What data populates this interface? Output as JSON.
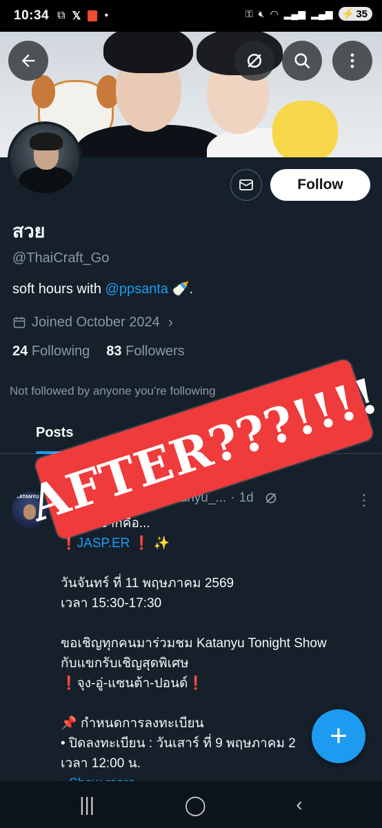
{
  "status_bar": {
    "time": "10:34",
    "battery": "35"
  },
  "banner": {
    "back_icon": "arrow-left-icon",
    "grok_icon": "grok-icon",
    "search_icon": "search-icon",
    "more_icon": "more-vertical-icon"
  },
  "profile": {
    "name": "สวย",
    "handle": "@ThaiCraft_Go",
    "bio_prefix": "soft hours with ",
    "bio_mention": "@ppsanta",
    "bio_suffix": " 🍼.",
    "joined": "Joined October 2024",
    "following_count": "24",
    "following_label": "Following",
    "followers_count": "83",
    "followers_label": "Followers",
    "not_followed": "Not followed by anyone you’re following",
    "follow_label": "Follow"
  },
  "tabs": {
    "posts": "Posts"
  },
  "tweet": {
    "handle": "@katanyu_...",
    "dot": "·",
    "time": "1d",
    "lines": [
      "…..ในเงาก็คือ...",
      "❗JASP.ER ❗ ✨",
      "",
      "วันจันทร์ ที่ 11 พฤษภาคม 2569",
      "เวลา 15:30-17:30",
      "",
      "ขอเชิญทุกคนมาร่วมชม Katanyu Tonight Show",
      "กับแขกรับเชิญสุดพิเศษ",
      "❗จุง-อู่-แซนต้า-ปอนด์❗",
      "",
      "📌 กำหนดการลงทะเบียน",
      "• ปิดลงทะเบียน : วันเสาร์ ที่ 9 พฤษภาคม 2",
      "เวลา 12:00 น."
    ],
    "show_more_prefix": "• ",
    "show_more": "Show more"
  },
  "sticker": {
    "text": "AFTER???!!!!"
  },
  "colors": {
    "accent": "#1d9bf0",
    "background": "#15202b",
    "sticker": "#ef3b3b"
  }
}
